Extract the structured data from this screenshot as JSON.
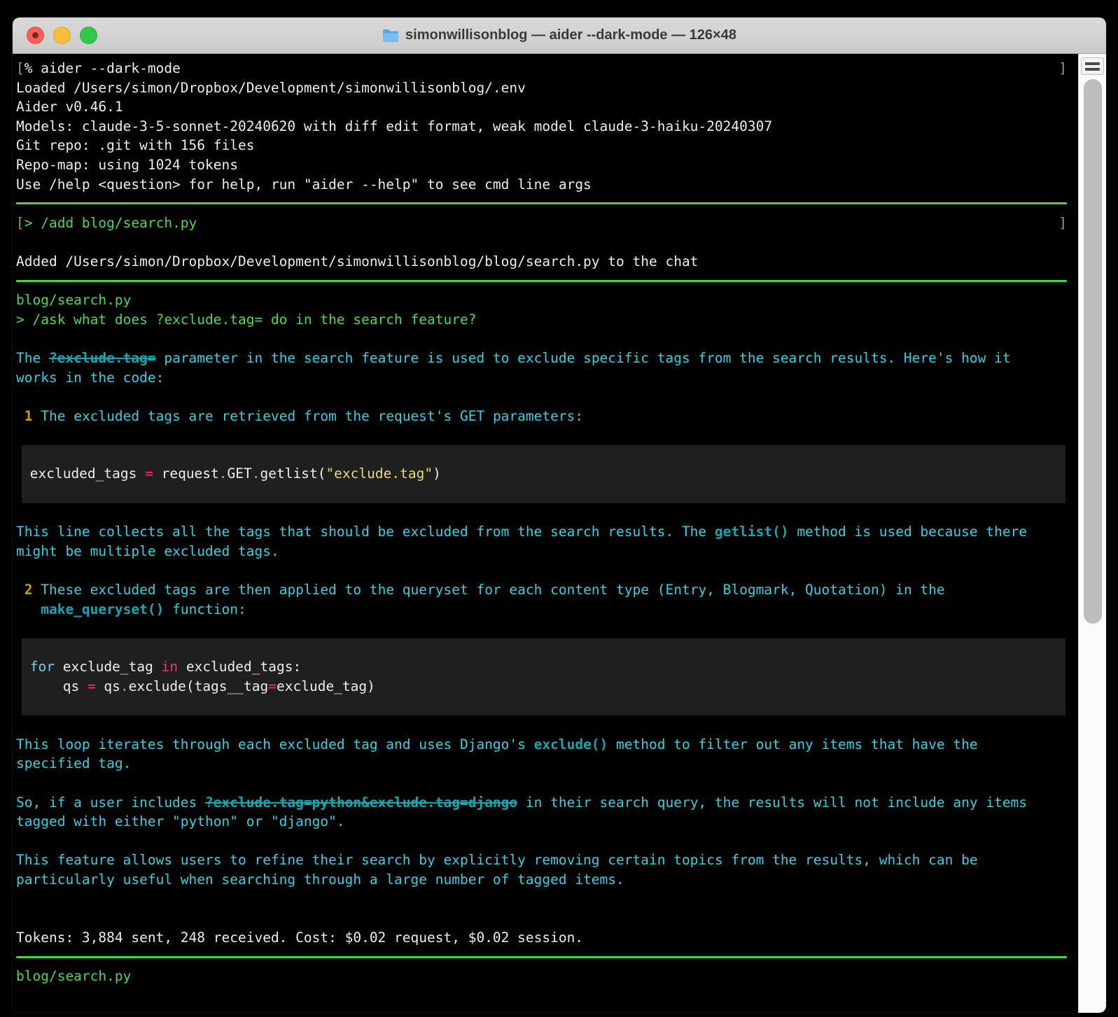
{
  "window": {
    "title": "simonwillisonblog — aider --dark-mode — 126×48",
    "traffic_lights": {
      "close": "close-button",
      "minimize": "minimize-button",
      "zoom": "zoom-button"
    },
    "icons": {
      "titlebar_proxy": "folder-icon",
      "scrollbar_top": "menu-lines-icon"
    }
  },
  "colors": {
    "terminal_background": "#000000",
    "titlebar": "#d2d2d2",
    "green": "#4cd94c",
    "rule_green": "#45d73d",
    "cyan": "#33d1e2",
    "inline_code_teal": "#12a8b5",
    "list_number_yellow": "#bfa40a",
    "code_pink": "#f92672",
    "code_blue": "#66d9ef",
    "code_string_yellow": "#e6db74",
    "code_block_bg": "#1e1f1e",
    "traffic_red": "#f4615b",
    "traffic_yellow": "#f8bd3d",
    "traffic_green": "#34c749"
  },
  "terminal": {
    "lines": [
      {
        "name": "shell-command-line",
        "type": "input",
        "right": "]",
        "segments": [
          {
            "s": "gr",
            "t": "["
          },
          {
            "s": "w",
            "t": "% aider --dark-mode"
          }
        ]
      },
      {
        "name": "env-loaded-line",
        "segments": [
          {
            "s": "w",
            "t": "Loaded /Users/simon/Dropbox/Development/simonwillisonblog/.env"
          }
        ]
      },
      {
        "name": "aider-version-line",
        "segments": [
          {
            "s": "w",
            "t": "Aider v0.46.1"
          }
        ]
      },
      {
        "name": "models-line",
        "segments": [
          {
            "s": "w",
            "t": "Models: claude-3-5-sonnet-20240620 with diff edit format, weak model claude-3-haiku-20240307"
          }
        ]
      },
      {
        "name": "git-repo-line",
        "segments": [
          {
            "s": "w",
            "t": "Git repo: .git with 156 files"
          }
        ]
      },
      {
        "name": "repo-map-line",
        "segments": [
          {
            "s": "w",
            "t": "Repo-map: using 1024 tokens"
          }
        ]
      },
      {
        "name": "help-hint-line",
        "segments": [
          {
            "s": "w",
            "t": "Use /help <question> for help, run \"aider --help\" to see cmd line args"
          }
        ]
      },
      {
        "name": "separator-rule",
        "type": "rule"
      },
      {
        "name": "add-command-line",
        "type": "input",
        "right": "]",
        "segments": [
          {
            "s": "gr",
            "t": "["
          },
          {
            "s": "g",
            "t": "> /add blog/search.py"
          }
        ]
      },
      {
        "name": "blank-line",
        "segments": []
      },
      {
        "name": "added-file-line",
        "segments": [
          {
            "s": "w",
            "t": "Added /Users/simon/Dropbox/Development/simonwillisonblog/blog/search.py to the chat"
          }
        ]
      },
      {
        "name": "separator-rule",
        "type": "rule"
      },
      {
        "name": "chat-file-line",
        "segments": [
          {
            "s": "g",
            "t": "blog/search.py"
          }
        ]
      },
      {
        "name": "ask-command-line",
        "segments": [
          {
            "s": "g",
            "t": "> /ask what does ?exclude.tag= do in the search feature?"
          }
        ]
      },
      {
        "name": "blank-line",
        "segments": []
      },
      {
        "name": "answer-paragraph",
        "segments": [
          {
            "s": "c",
            "t": "The "
          },
          {
            "s": "cs",
            "t": "?exclude.tag="
          },
          {
            "s": "c",
            "t": " parameter in the search feature is used to exclude specific tags from the search results. Here's how it"
          }
        ]
      },
      {
        "name": "answer-paragraph",
        "segments": [
          {
            "s": "c",
            "t": "works in the code:"
          }
        ]
      },
      {
        "name": "blank-line",
        "segments": []
      },
      {
        "name": "list-item-1",
        "segments": [
          {
            "s": "c",
            "t": " "
          },
          {
            "s": "y",
            "t": "1"
          },
          {
            "s": "c",
            "t": " The excluded tags are retrieved from the request's GET parameters:"
          }
        ]
      },
      {
        "name": "blank-line",
        "segments": []
      },
      {
        "name": "code-block-padding",
        "block": 1,
        "segments": []
      },
      {
        "name": "code-line",
        "block": 1,
        "segments": [
          {
            "s": "w",
            "t": " excluded_tags "
          },
          {
            "s": "pk",
            "t": "="
          },
          {
            "s": "w",
            "t": " request"
          },
          {
            "s": "dot",
            "t": "."
          },
          {
            "s": "w",
            "t": "GET"
          },
          {
            "s": "dot",
            "t": "."
          },
          {
            "s": "w",
            "t": "getlist("
          },
          {
            "s": "str",
            "t": "\"exclude.tag\""
          },
          {
            "s": "w",
            "t": ")"
          }
        ]
      },
      {
        "name": "code-block-padding",
        "block": 1,
        "segments": []
      },
      {
        "name": "blank-line",
        "segments": []
      },
      {
        "name": "answer-paragraph",
        "segments": [
          {
            "s": "c",
            "t": "This line collects all the tags that should be excluded from the search results. The "
          },
          {
            "s": "cc",
            "t": "getlist()"
          },
          {
            "s": "c",
            "t": " method is used because there"
          }
        ]
      },
      {
        "name": "answer-paragraph",
        "segments": [
          {
            "s": "c",
            "t": "might be multiple excluded tags."
          }
        ]
      },
      {
        "name": "blank-line",
        "segments": []
      },
      {
        "name": "list-item-2",
        "segments": [
          {
            "s": "c",
            "t": " "
          },
          {
            "s": "y",
            "t": "2"
          },
          {
            "s": "c",
            "t": " These excluded tags are then applied to the queryset for each content type (Entry, Blogmark, Quotation) in the"
          }
        ]
      },
      {
        "name": "list-item-2-cont",
        "segments": [
          {
            "s": "c",
            "t": "   "
          },
          {
            "s": "cc",
            "t": "make_queryset()"
          },
          {
            "s": "c",
            "t": " function:"
          }
        ]
      },
      {
        "name": "blank-line",
        "segments": []
      },
      {
        "name": "code-block-padding",
        "block": 2,
        "segments": []
      },
      {
        "name": "code-line",
        "block": 2,
        "segments": [
          {
            "s": "w",
            "t": " "
          },
          {
            "s": "bl",
            "t": "for"
          },
          {
            "s": "w",
            "t": " exclude_tag "
          },
          {
            "s": "pk",
            "t": "in"
          },
          {
            "s": "w",
            "t": " excluded_tags:"
          }
        ]
      },
      {
        "name": "code-line",
        "block": 2,
        "segments": [
          {
            "s": "w",
            "t": "     qs "
          },
          {
            "s": "pk",
            "t": "="
          },
          {
            "s": "w",
            "t": " qs"
          },
          {
            "s": "dot",
            "t": "."
          },
          {
            "s": "w",
            "t": "exclude(tags__tag"
          },
          {
            "s": "pk",
            "t": "="
          },
          {
            "s": "w",
            "t": "exclude_tag)"
          }
        ]
      },
      {
        "name": "code-block-padding",
        "block": 2,
        "segments": []
      },
      {
        "name": "blank-line",
        "segments": []
      },
      {
        "name": "answer-paragraph",
        "segments": [
          {
            "s": "c",
            "t": "This loop iterates through each excluded tag and uses Django's "
          },
          {
            "s": "cc",
            "t": "exclude()"
          },
          {
            "s": "c",
            "t": " method to filter out any items that have the"
          }
        ]
      },
      {
        "name": "answer-paragraph",
        "segments": [
          {
            "s": "c",
            "t": "specified tag."
          }
        ]
      },
      {
        "name": "blank-line",
        "segments": []
      },
      {
        "name": "answer-paragraph",
        "segments": [
          {
            "s": "c",
            "t": "So, if a user includes "
          },
          {
            "s": "cs",
            "t": "?exclude.tag=python&exclude.tag=django"
          },
          {
            "s": "c",
            "t": " in their search query, the results will not include any items"
          }
        ]
      },
      {
        "name": "answer-paragraph",
        "segments": [
          {
            "s": "c",
            "t": "tagged with either \"python\" or \"django\"."
          }
        ]
      },
      {
        "name": "blank-line",
        "segments": []
      },
      {
        "name": "answer-paragraph",
        "segments": [
          {
            "s": "c",
            "t": "This feature allows users to refine their search by explicitly removing certain topics from the results, which can be"
          }
        ]
      },
      {
        "name": "answer-paragraph",
        "segments": [
          {
            "s": "c",
            "t": "particularly useful when searching through a large number of tagged items."
          }
        ]
      },
      {
        "name": "blank-line",
        "segments": []
      },
      {
        "name": "blank-line",
        "segments": []
      },
      {
        "name": "tokens-cost-line",
        "segments": [
          {
            "s": "w",
            "t": "Tokens: 3,884 sent, 248 received. Cost: $0.02 request, $0.02 session."
          }
        ]
      },
      {
        "name": "separator-rule",
        "type": "rule"
      },
      {
        "name": "chat-file-line",
        "segments": [
          {
            "s": "g",
            "t": "blog/search.py"
          }
        ]
      }
    ]
  }
}
